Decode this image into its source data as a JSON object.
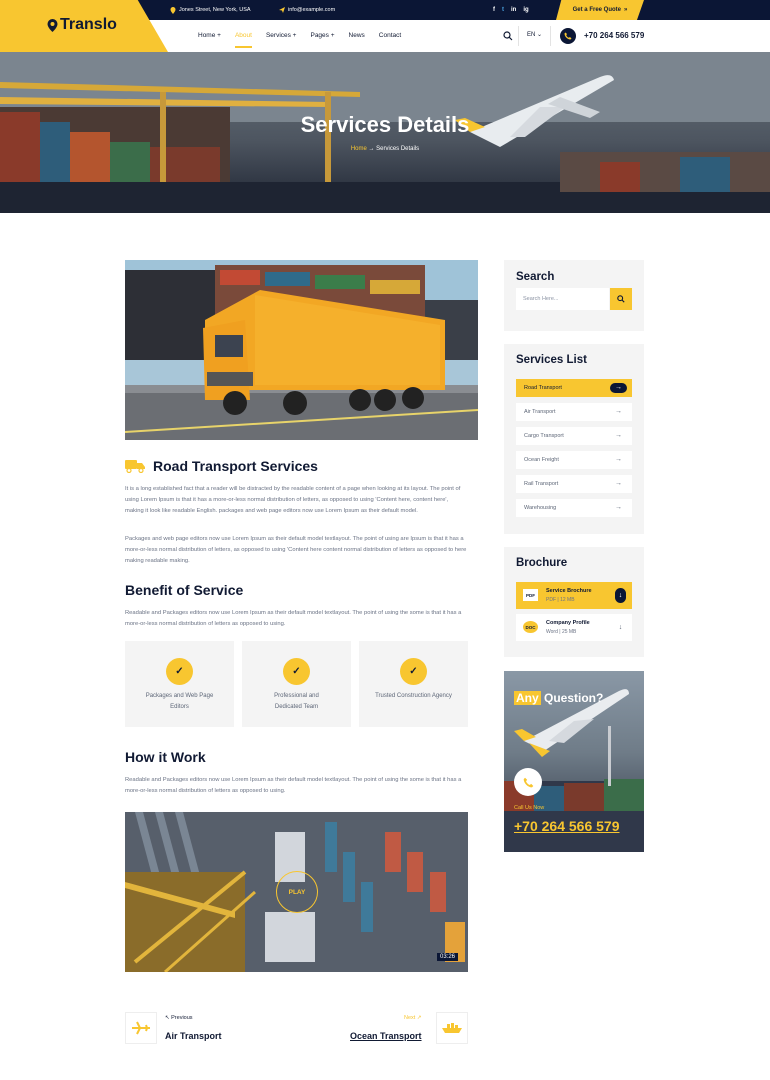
{
  "topbar": {
    "address": "Jones Street, New York, USA",
    "email": "info@example.com",
    "quote_button": "Get a Free Quote",
    "social": [
      "f",
      "t",
      "in",
      "ig"
    ]
  },
  "header": {
    "logo": "Translo",
    "nav": [
      {
        "label": "Home +",
        "active": false
      },
      {
        "label": "About",
        "active": true
      },
      {
        "label": "Services +",
        "active": false
      },
      {
        "label": "Pages +",
        "active": false
      },
      {
        "label": "News",
        "active": false
      },
      {
        "label": "Contact",
        "active": false
      }
    ],
    "language": "EN",
    "phone": "+70 264 566 579"
  },
  "hero": {
    "title": "Services Details",
    "breadcrumb_home": "Home",
    "breadcrumb_sep": "→",
    "breadcrumb_current": "Services Details"
  },
  "main": {
    "service_title": "Road Transport Services",
    "p1": "It is a long established fact that a reader will be distracted by the readable content of a page when looking at its layout. The point of using Lorem Ipsum is that it has a more-or-less normal distribution of letters, as opposed to using 'Content here, content here', making it look like readable English. packages and web page editors now use Lorem Ipsum as their default model.",
    "p2": "Packages and web page editors now use Lorem Ipsum as their default model textlayout. The point of using are Ipsum is that it has a more-or-less normal distribution of letters, as opposed to using 'Content here content normal distribution of letters as opposed to here making readable making.",
    "benefit_title": "Benefit of Service",
    "benefit_text": "Readable and Packages editors now use Lorem Ipsum as their default model textlayout. The point of using the some is that it has a more-or-less normal distribution of letters as opposed to using.",
    "benefits": [
      {
        "label": "Packages and Web Page Editors"
      },
      {
        "label": "Professional and Dedicated Team"
      },
      {
        "label": "Trusted Construction Agency"
      }
    ],
    "how_title": "How it Work",
    "how_text": "Readable and Packages editors now use Lorem Ipsum as their default model textlayout. The point of using the some is that it has a more-or-less normal distribution of letters as opposed to using.",
    "video_play": "PLAY",
    "video_duration": "03:26",
    "prev_label": "Previous",
    "prev_title": "Air Transport",
    "next_label": "Next",
    "next_title": "Ocean Transport"
  },
  "sidebar": {
    "search_title": "Search",
    "search_placeholder": "Search Here...",
    "services_title": "Services List",
    "services": [
      {
        "label": "Road Transport",
        "active": true
      },
      {
        "label": "Air Transport",
        "active": false
      },
      {
        "label": "Cargo Transport",
        "active": false
      },
      {
        "label": "Ocean Freight",
        "active": false
      },
      {
        "label": "Rail Transport",
        "active": false
      },
      {
        "label": "Warehousing",
        "active": false
      }
    ],
    "brochure_title": "Brochure",
    "brochures": [
      {
        "name": "Service Brochure",
        "type": "PDF",
        "size": "12 MB",
        "badge": "PDF",
        "active": true
      },
      {
        "name": "Company Profile",
        "type": "Word",
        "size": "25 MB",
        "badge": "DOC",
        "active": false
      }
    ],
    "question_title_hl": "Any",
    "question_title_rest": " Question?",
    "call_label": "Call Us Now",
    "call_number": "+70 264 566 579"
  },
  "colors": {
    "accent": "#f8c630",
    "navy": "#0b1635"
  }
}
